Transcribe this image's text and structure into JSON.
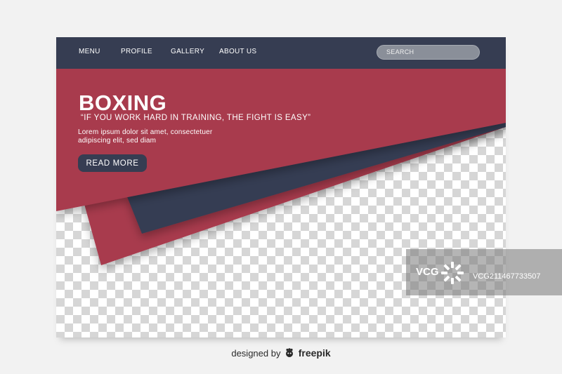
{
  "nav": {
    "items": [
      {
        "label": "MENU"
      },
      {
        "label": "PROFILE"
      },
      {
        "label": "GALLERY"
      },
      {
        "label": "ABOUT US"
      }
    ],
    "search_placeholder": "SEARCH"
  },
  "hero": {
    "title": "BOXING",
    "quote": "“IF YOU WORK HARD IN TRAINING, THE FIGHT IS EASY”",
    "body_lines": [
      "Lorem ipsum dolor sit amet, consectetuer",
      "adipiscing elit, sed diam"
    ],
    "cta_label": "READ MORE"
  },
  "watermark": {
    "logo": "VCG",
    "id_text": "VCG211467733507"
  },
  "credit": {
    "prefix": "designed by",
    "brand": "freepik"
  },
  "colors": {
    "navy": "#363d52",
    "crimson": "#a83a4e",
    "background": "#f2f2f2"
  }
}
